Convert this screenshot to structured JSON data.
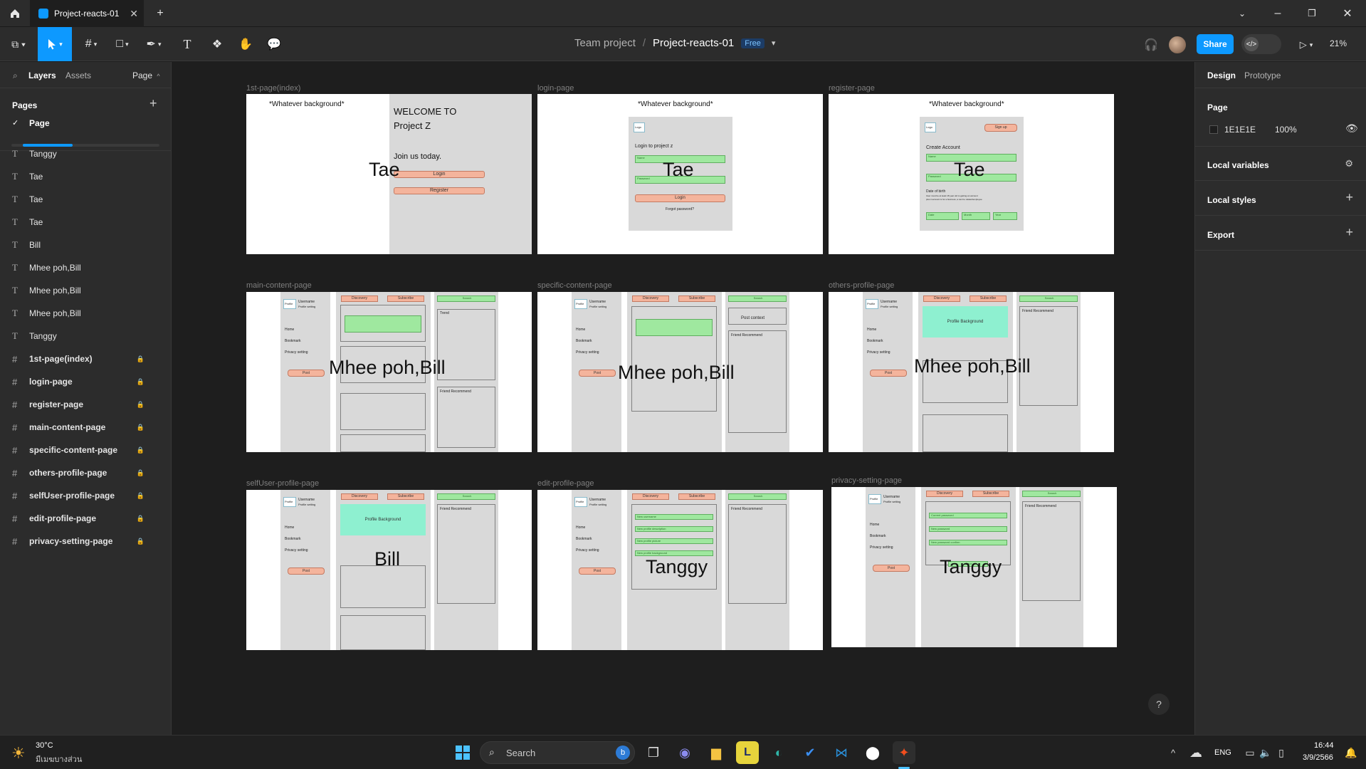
{
  "window": {
    "tab_title": "Project-reacts-01",
    "colors": {
      "bg": "#1e1e1e",
      "panel": "#2c2c2c",
      "accent": "#0d99ff"
    }
  },
  "toolbar": {
    "team": "Team project",
    "separator": "/",
    "file_name": "Project-reacts-01",
    "plan_badge": "Free",
    "share_label": "Share",
    "zoom": "21%"
  },
  "left_panel": {
    "tabs": {
      "layers": "Layers",
      "assets": "Assets",
      "page": "Page"
    },
    "pages_header": "Pages",
    "current_page": "Page",
    "layers": [
      {
        "type": "text",
        "name": "Tanggy"
      },
      {
        "type": "text",
        "name": "Tae"
      },
      {
        "type": "text",
        "name": "Tae"
      },
      {
        "type": "text",
        "name": "Tae"
      },
      {
        "type": "text",
        "name": "Bill"
      },
      {
        "type": "text",
        "name": "Mhee poh,Bill"
      },
      {
        "type": "text",
        "name": "Mhee poh,Bill"
      },
      {
        "type": "text",
        "name": "Mhee poh,Bill"
      },
      {
        "type": "text",
        "name": "Tanggy"
      },
      {
        "type": "frame",
        "name": "1st-page(index)"
      },
      {
        "type": "frame",
        "name": "login-page"
      },
      {
        "type": "frame",
        "name": "register-page"
      },
      {
        "type": "frame",
        "name": "main-content-page"
      },
      {
        "type": "frame",
        "name": "specific-content-page"
      },
      {
        "type": "frame",
        "name": "others-profile-page"
      },
      {
        "type": "frame",
        "name": "selfUser-profile-page"
      },
      {
        "type": "frame",
        "name": "edit-profile-page"
      },
      {
        "type": "frame",
        "name": "privacy-setting-page"
      }
    ]
  },
  "right_panel": {
    "tabs": {
      "design": "Design",
      "prototype": "Prototype"
    },
    "page_section": "Page",
    "page_color": "1E1E1E",
    "page_opacity": "100%",
    "local_variables": "Local variables",
    "local_styles": "Local styles",
    "export": "Export"
  },
  "canvas": {
    "frames": {
      "f1": {
        "label": "1st-page(index)",
        "bg_note": "*Whatever background*",
        "welcome1": "WELCOME TO",
        "welcome2": "Project Z",
        "join": "Join us today.",
        "login": "Login",
        "register": "Register",
        "overlay": "Tae"
      },
      "f2": {
        "label": "login-page",
        "bg_note": "*Whatever background*",
        "logo": "Logo",
        "heading": "Login to project z",
        "name": "Name",
        "password": "Password",
        "login": "Login",
        "forgot": "Forgot password?",
        "overlay": "Tae"
      },
      "f3": {
        "label": "register-page",
        "bg_note": "*Whatever background*",
        "logo": "Logo",
        "signup": "Sign up",
        "heading": "Create Account",
        "name": "Name",
        "password": "Password",
        "dob": "Date of birth",
        "note": "User must be at least 18 year old to getting an account",
        "note2": "plus it account is for a business, a can be related/employee",
        "date": "Date",
        "month": "Month",
        "year": "Year",
        "overlay": "Tae"
      },
      "f4": {
        "label": "main-content-page",
        "profile": "Profile",
        "username": "Username",
        "profile_setting": "Profile setting",
        "home": "Home",
        "bookmark": "Bookmark",
        "privacy": "Privacy setting",
        "post": "Post",
        "discovery": "Discovery",
        "subscribe": "Subscribe",
        "search": "Search",
        "trend": "Trend",
        "friend": "Friend Recommend",
        "overlay": "Mhee poh,Bill"
      },
      "f5": {
        "label": "specific-content-page",
        "profile": "Profile",
        "username": "Username",
        "profile_setting": "Profile setting",
        "home": "Home",
        "bookmark": "Bookmark",
        "privacy": "Privacy setting",
        "post": "Post",
        "discovery": "Discovery",
        "subscribe": "Subscribe",
        "search": "Search",
        "post_context": "Post context",
        "friend": "Friend Recommend",
        "overlay": "Mhee poh,Bill"
      },
      "f6": {
        "label": "others-profile-page",
        "profile": "Profile",
        "username": "Username",
        "profile_setting": "Profile setting",
        "home": "Home",
        "bookmark": "Bookmark",
        "privacy": "Privacy setting",
        "post": "Post",
        "discovery": "Discovery",
        "subscribe": "Subscribe",
        "search": "Search",
        "profile_bg": "Profile Background",
        "friend": "Friend Recommend",
        "overlay": "Mhee poh,Bill"
      },
      "f7": {
        "label": "selfUser-profile-page",
        "profile": "Profile",
        "username": "Username",
        "profile_setting": "Profile setting",
        "home": "Home",
        "bookmark": "Bookmark",
        "privacy": "Privacy setting",
        "post": "Post",
        "discovery": "Discovery",
        "subscribe": "Subscribe",
        "search": "Search",
        "profile_bg": "Profile Background",
        "friend": "Friend Recommend",
        "overlay": "Bill"
      },
      "f8": {
        "label": "edit-profile-page",
        "profile": "Profile",
        "username": "Username",
        "profile_setting": "Profile setting",
        "home": "Home",
        "bookmark": "Bookmark",
        "privacy": "Privacy setting",
        "post": "Post",
        "discovery": "Discovery",
        "subscribe": "Subscribe",
        "search": "Search",
        "new_username": "New username",
        "new_desc": "New profile description",
        "new_pic": "New profile picture",
        "new_bg": "New profile background",
        "friend": "Friend Recommend",
        "overlay": "Tanggy"
      },
      "f9": {
        "label": "privacy-setting-page",
        "profile": "Profile",
        "username": "Username",
        "profile_setting": "Profile setting",
        "home": "Home",
        "bookmark": "Bookmark",
        "privacy": "Privacy setting",
        "post": "Post",
        "discovery": "Discovery",
        "subscribe": "Subscribe",
        "search": "Search",
        "current_pw": "Current password",
        "new_pw": "New password",
        "confirm_pw": "New password confirm",
        "save": "Save",
        "friend": "Friend Recommend",
        "overlay": "Tanggy"
      }
    }
  },
  "taskbar": {
    "weather_temp": "30°C",
    "weather_desc": "มีเมฆบางส่วน",
    "search": "Search",
    "lang": "ENG",
    "time": "16:44",
    "date": "3/9/2566"
  }
}
